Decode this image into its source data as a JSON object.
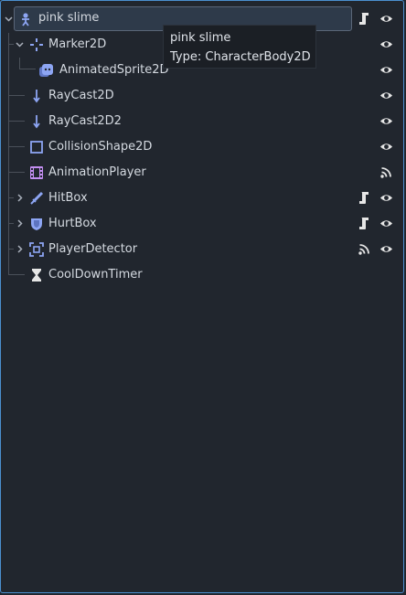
{
  "tree": {
    "root": {
      "label": "pink slime",
      "icon": "character-body-2d-icon",
      "expanded": true
    },
    "nodes": [
      {
        "label": "Marker2D",
        "icon": "marker2d-icon"
      },
      {
        "label": "AnimatedSprite2D",
        "icon": "animated-sprite2d-icon"
      },
      {
        "label": "RayCast2D",
        "icon": "raycast2d-icon"
      },
      {
        "label": "RayCast2D2",
        "icon": "raycast2d-icon"
      },
      {
        "label": "CollisionShape2D",
        "icon": "collision-shape2d-icon"
      },
      {
        "label": "AnimationPlayer",
        "icon": "animation-player-icon"
      },
      {
        "label": "HitBox",
        "icon": "hitbox-icon"
      },
      {
        "label": "HurtBox",
        "icon": "hurtbox-icon"
      },
      {
        "label": "PlayerDetector",
        "icon": "player-detector-icon"
      },
      {
        "label": "CoolDownTimer",
        "icon": "timer-icon"
      }
    ]
  },
  "tooltip": {
    "name": "pink slime",
    "type": "Type: CharacterBody2D"
  },
  "colors": {
    "background": "#21262e",
    "selection_border": "#4b8fcf",
    "node2d_blue": "#8da5f3",
    "area_blue": "#8da5f3",
    "animation_purple": "#c38ef1",
    "text": "#d4d9e0"
  }
}
